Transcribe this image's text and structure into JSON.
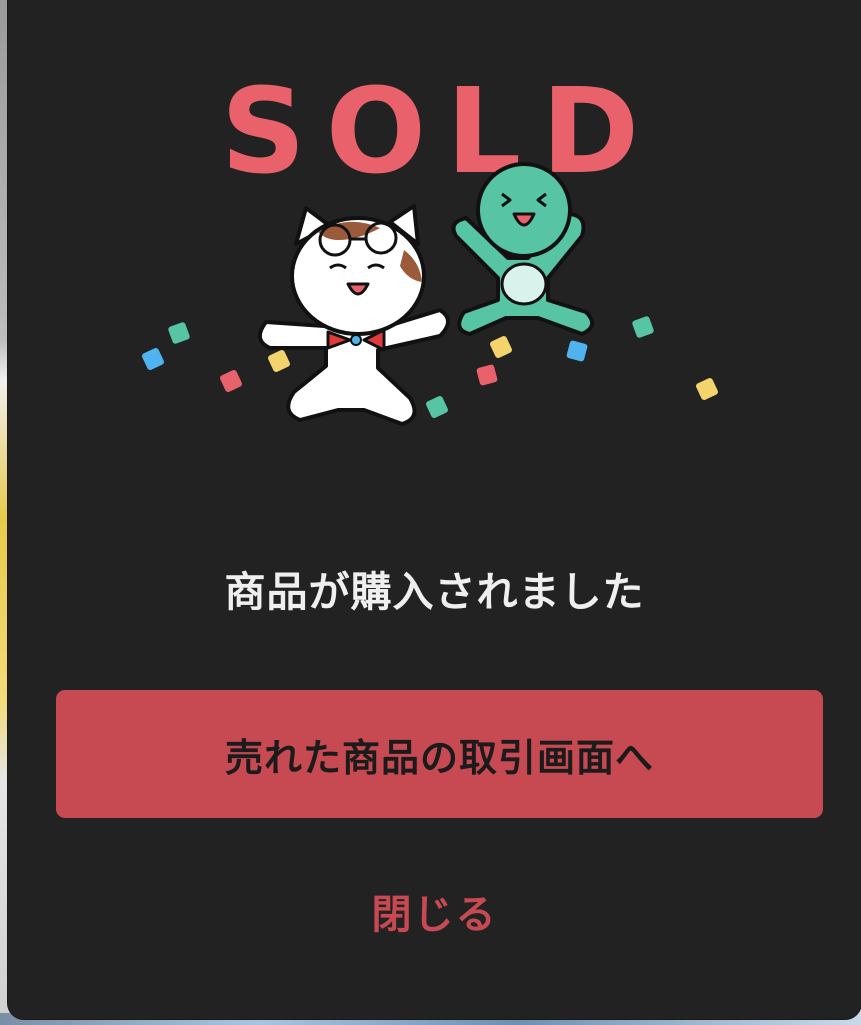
{
  "dialog": {
    "illustration": {
      "headline": "SOLD",
      "colors": {
        "headline": "#e9616a",
        "cat_body": "#ffffff",
        "cat_patch": "#9b5b3a",
        "bowtie": "#e03a3a",
        "mascot_body": "#57c5a4",
        "mascot_belly": "#d9f3ec",
        "confetti": [
          "#4fb3f0",
          "#57c5a4",
          "#e9616a",
          "#f3d36b"
        ]
      }
    },
    "message": "商品が購入されました",
    "primary_button_label": "売れた商品の取引画面へ",
    "close_label": "閉じる",
    "accent_color": "#c74a52",
    "background_color": "#232223"
  }
}
